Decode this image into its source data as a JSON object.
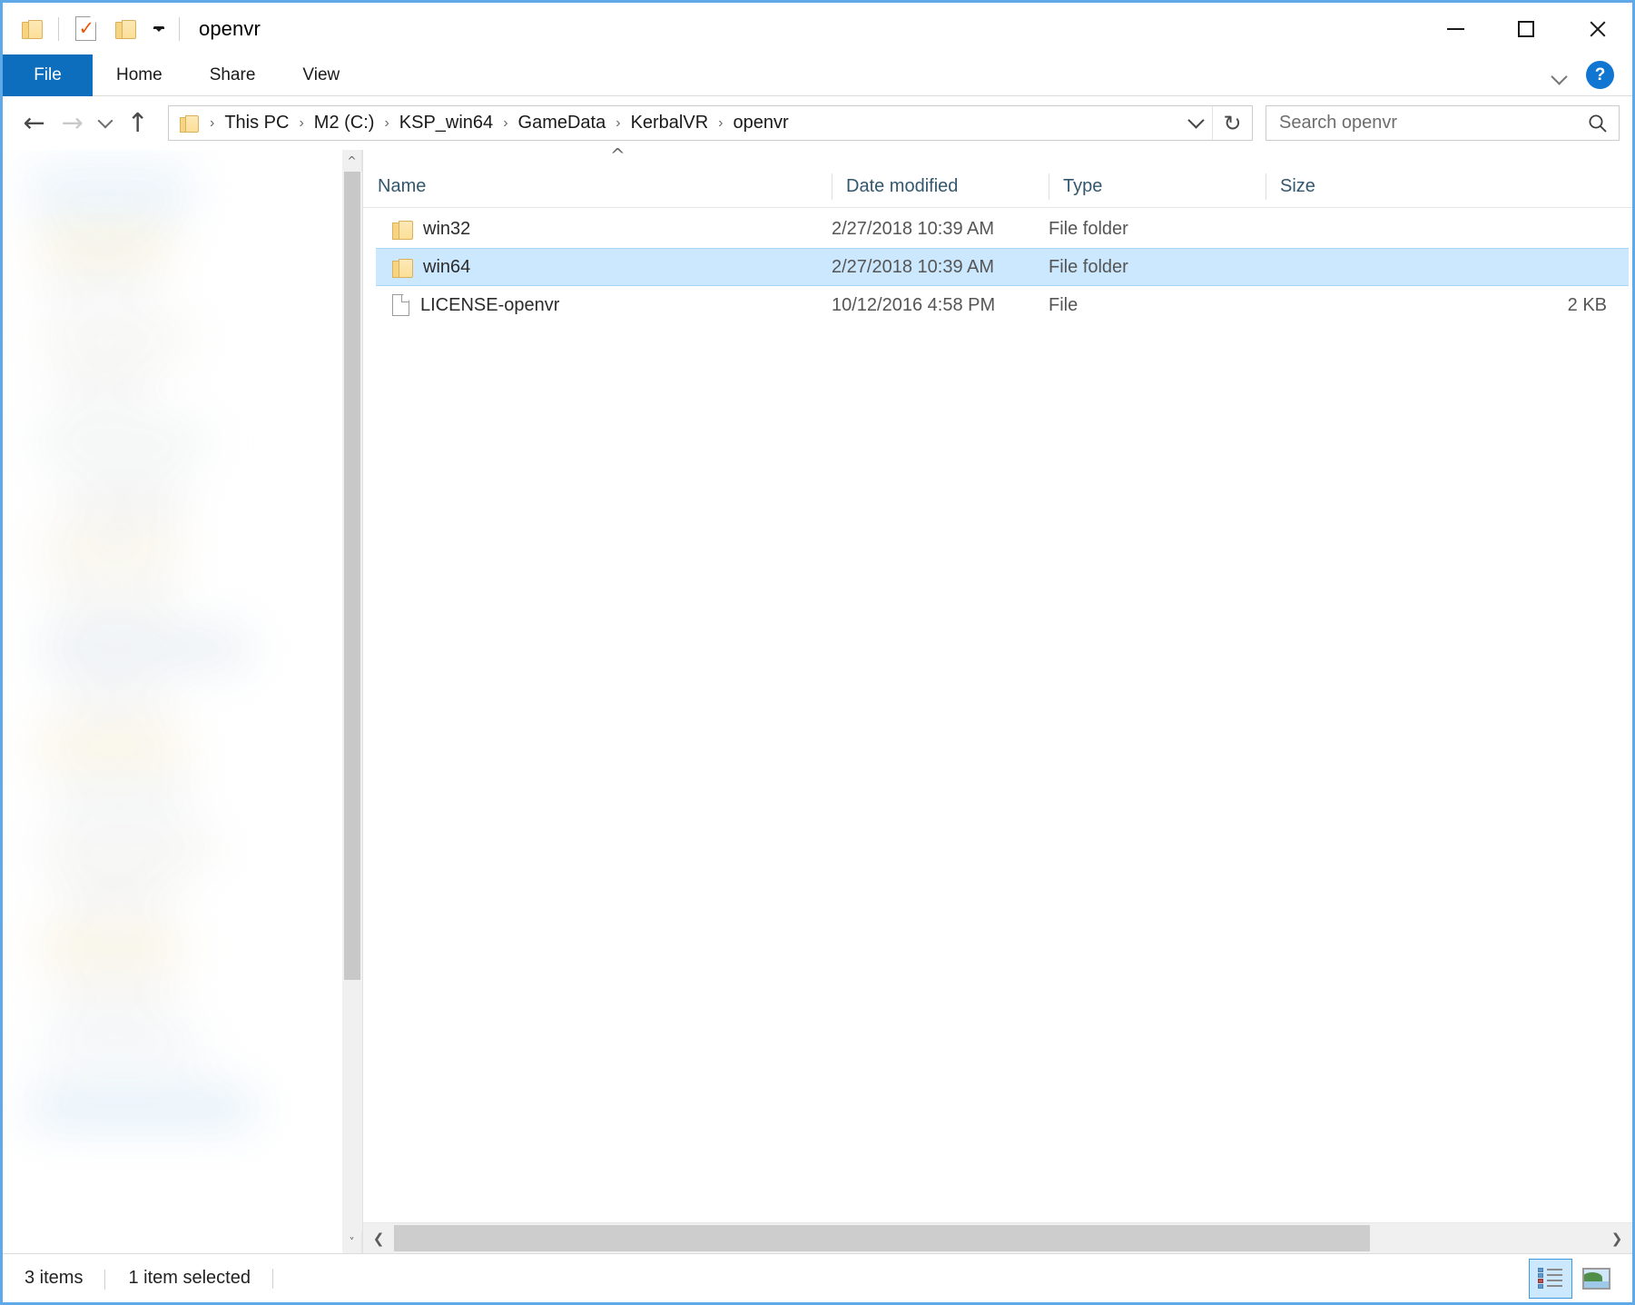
{
  "window": {
    "title": "openvr",
    "quick_access": [
      {
        "name": "folder-icon",
        "label": "Folder"
      },
      {
        "name": "properties-icon",
        "label": "Properties"
      },
      {
        "name": "new-folder-icon",
        "label": "New folder"
      },
      {
        "name": "customize-quick-access-icon",
        "label": "Customize Quick Access Toolbar"
      }
    ],
    "controls": {
      "minimize": "Minimize",
      "maximize": "Maximize",
      "close": "Close"
    }
  },
  "ribbon": {
    "tabs": [
      {
        "label": "File",
        "active": true
      },
      {
        "label": "Home",
        "active": false
      },
      {
        "label": "Share",
        "active": false
      },
      {
        "label": "View",
        "active": false
      }
    ],
    "expand_label": "Expand the Ribbon",
    "help_label": "?"
  },
  "address": {
    "back_label": "Back",
    "forward_label": "Forward",
    "recent_label": "Recent locations",
    "up_label": "Up to GameData\\KerbalVR",
    "breadcrumbs": [
      "This PC",
      "M2 (C:)",
      "KSP_win64",
      "GameData",
      "KerbalVR",
      "openvr"
    ],
    "separator": "›",
    "dropdown_label": "Previous locations",
    "refresh_label": "↻"
  },
  "search": {
    "value": "",
    "placeholder": "Search openvr"
  },
  "columns": [
    {
      "key": "name",
      "label": "Name",
      "sorted": true,
      "sort_dir": "asc"
    },
    {
      "key": "date",
      "label": "Date modified",
      "sorted": false
    },
    {
      "key": "type",
      "label": "Type",
      "sorted": false
    },
    {
      "key": "size",
      "label": "Size",
      "sorted": false
    }
  ],
  "files": [
    {
      "name": "win32",
      "date": "2/27/2018 10:39 AM",
      "type": "File folder",
      "size": "",
      "icon": "folder-icon",
      "selected": false
    },
    {
      "name": "win64",
      "date": "2/27/2018 10:39 AM",
      "type": "File folder",
      "size": "",
      "icon": "folder-icon",
      "selected": true
    },
    {
      "name": "LICENSE-openvr",
      "date": "10/12/2016 4:58 PM",
      "type": "File",
      "size": "2 KB",
      "icon": "file-icon",
      "selected": false
    }
  ],
  "status": {
    "item_count": "3 items",
    "selection": "1 item selected",
    "views": [
      {
        "name": "details-view-button",
        "label": "Details view",
        "active": true
      },
      {
        "name": "large-icons-view-button",
        "label": "Large icons view",
        "active": false
      }
    ]
  },
  "colors": {
    "accent": "#0d6ebd",
    "selection": "#cce8ff",
    "selection_border": "#a9d6f5",
    "window_border": "#60a9e8",
    "header_text": "#33576e",
    "folder": "#fcdf97",
    "help_blue": "#1076d1"
  }
}
